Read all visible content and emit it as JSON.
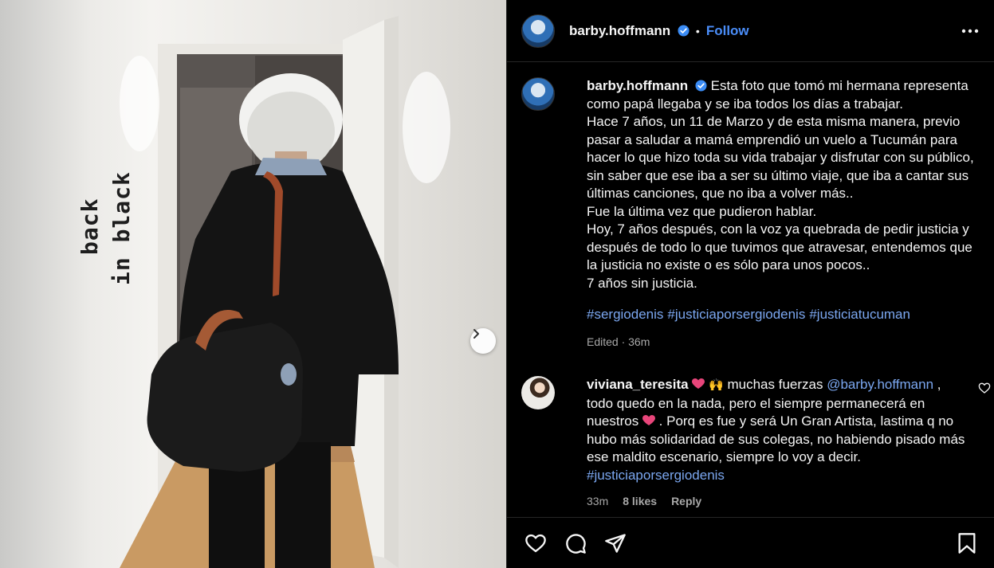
{
  "photo": {
    "story_text_line1": "back",
    "story_text_line2": "in black"
  },
  "header": {
    "username": "barby.hoffmann",
    "separator": "•",
    "follow_label": "Follow"
  },
  "caption": {
    "username": "barby.hoffmann",
    "lines": [
      "Esta foto que tomó mi hermana representa",
      "como papá llegaba y se iba todos los días a trabajar.",
      "Hace 7 años, un 11 de Marzo y de esta misma manera, previo",
      "pasar a saludar a mamá emprendió un vuelo a Tucumán para",
      "hacer lo que hizo toda su vida trabajar y disfrutar con su público,",
      "sin saber que ese iba a ser su último viaje, que iba a cantar sus",
      "últimas canciones, que no iba a volver más..",
      "Fue la última vez que pudieron hablar.",
      "Hoy, 7 años después, con la voz ya quebrada de pedir justicia y",
      "después de todo lo que tuvimos que atravesar, entendemos que",
      "la justicia no existe o es sólo para unos pocos..",
      "7 años sin justicia."
    ],
    "hashtags": [
      "#sergiodenis",
      "#justiciaporsergiodenis",
      "#justiciatucuman"
    ],
    "meta": "Edited · 36m"
  },
  "comment": {
    "username": "viviana_teresita",
    "text_part1": "muchas fuerzas",
    "mention": "@barby.hoffmann",
    "text_part2": ",",
    "line2": "todo quedo en la nada, pero el siempre permanecerá en",
    "line3a": "nuestros",
    "line3b": ". Porq es fue y será Un Gran Artista, lastima q no",
    "line4": "hubo más solidaridad de sus colegas, no habiendo pisado más",
    "line5": "ese maldito escenario, siempre lo voy a decir.",
    "hashtag": "#justiciaporsergiodenis",
    "time": "33m",
    "likes": "8 likes",
    "reply_label": "Reply"
  },
  "icons": {
    "like": "heart-icon",
    "comment": "comment-icon",
    "share": "send-icon",
    "save": "bookmark-icon",
    "more": "more-horizontal-icon",
    "next": "chevron-right-icon"
  },
  "colors": {
    "accent": "#4a8df8",
    "link": "#7ba7f0",
    "muted": "#a8a8a8",
    "background": "#000000",
    "emoji_heart": "#e8457a"
  }
}
